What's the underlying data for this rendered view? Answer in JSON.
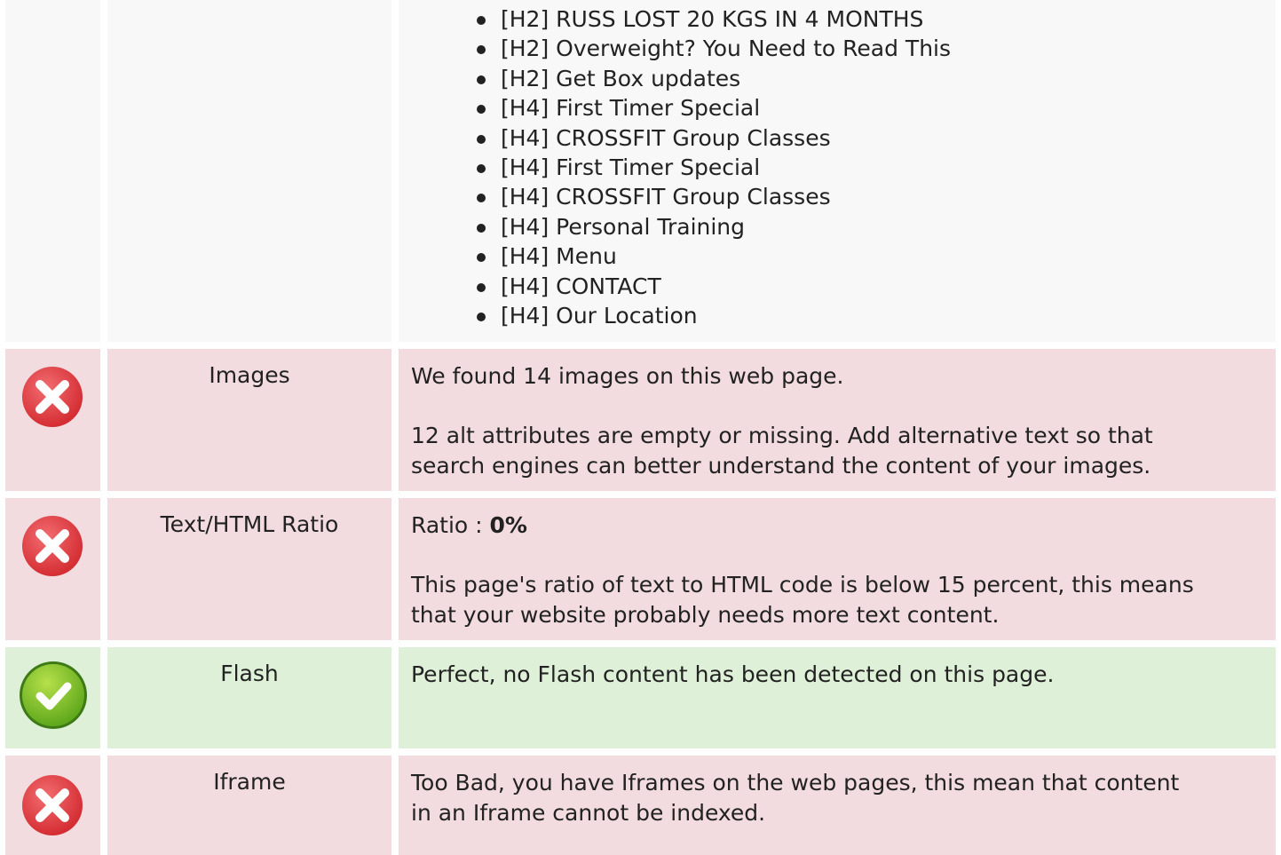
{
  "colors": {
    "bad_row": "#f2dcdf",
    "good_row": "#dff0d8",
    "neutral_row": "#f8f8f8",
    "error_icon": "#e0353a",
    "ok_icon": "#7cbf2a"
  },
  "headings": {
    "items": [
      "[H2] RUSS LOST 20 KGS IN 4 MONTHS",
      "[H2] Overweight? You Need to Read This",
      "[H2] Get Box updates",
      "[H4] First Timer Special",
      "[H4] CROSSFIT Group Classes",
      "[H4] First Timer Special",
      "[H4] CROSSFIT Group Classes",
      "[H4] Personal Training",
      "[H4] Menu",
      "[H4] CONTACT",
      "[H4] Our Location"
    ]
  },
  "images": {
    "status_icon": "error-icon",
    "label": "Images",
    "line1": "We found 14 images on this web page.",
    "line2": "12 alt attributes are empty or missing. Add alternative text so that",
    "line3": "search engines can better understand the content of your images."
  },
  "ratio": {
    "status_icon": "error-icon",
    "label": "Text/HTML Ratio",
    "prefix": "Ratio : ",
    "value": "0%",
    "line2": "This page's ratio of text to HTML code is below 15 percent, this means",
    "line3": "that your website probably needs more text content."
  },
  "flash": {
    "status_icon": "check-icon",
    "label": "Flash",
    "line1": "Perfect, no Flash content has been detected on this page."
  },
  "iframe": {
    "status_icon": "error-icon",
    "label": "Iframe",
    "line1": "Too Bad, you have Iframes on the web pages, this mean that content",
    "line2": "in an Iframe cannot be indexed."
  }
}
